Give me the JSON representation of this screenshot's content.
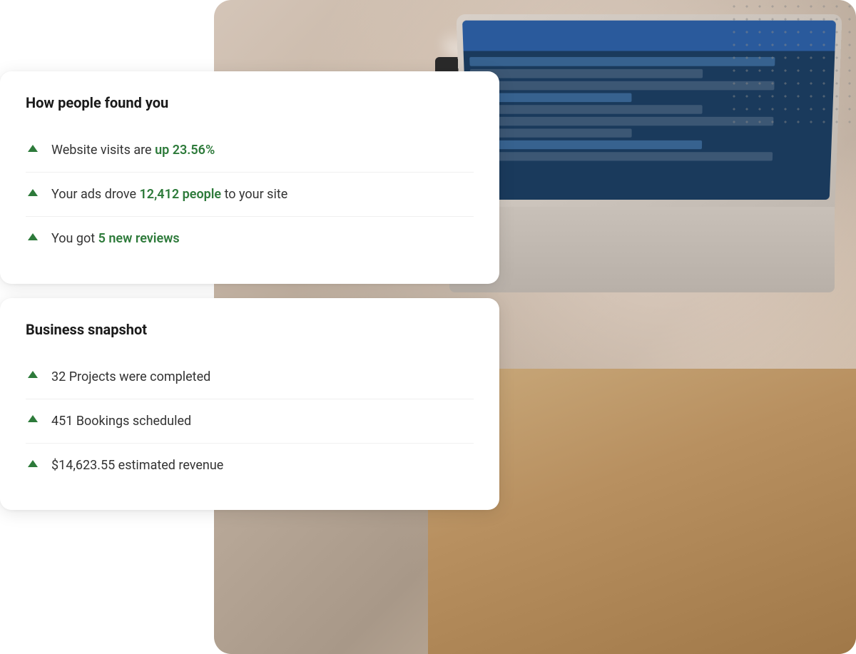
{
  "page": {
    "background_color": "#ffffff"
  },
  "card1": {
    "title": "How people found you",
    "items": [
      {
        "id": "website-visits",
        "text_before": "Website visits are ",
        "highlight": "up 23.56%",
        "text_after": ""
      },
      {
        "id": "ads-drove",
        "text_before": "Your ads drove ",
        "highlight": "12,412 people",
        "text_after": " to your site"
      },
      {
        "id": "new-reviews",
        "text_before": "You got ",
        "highlight": "5 new reviews",
        "text_after": ""
      }
    ]
  },
  "card2": {
    "title": "Business snapshot",
    "items": [
      {
        "id": "projects",
        "text_before": "32 Projects were completed",
        "highlight": "",
        "text_after": ""
      },
      {
        "id": "bookings",
        "text_before": "451 Bookings scheduled",
        "highlight": "",
        "text_after": ""
      },
      {
        "id": "revenue",
        "text_before": "$14,623.55 estimated revenue",
        "highlight": "",
        "text_after": ""
      }
    ]
  },
  "dot_pattern": {
    "color": "#999",
    "opacity": "0.5"
  }
}
